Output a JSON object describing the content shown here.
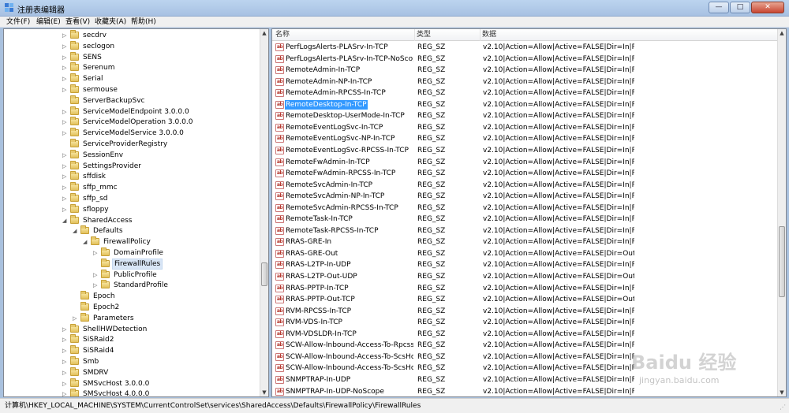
{
  "window": {
    "title": "注册表编辑器",
    "min_symbol": "—",
    "max_symbol": "□",
    "close_symbol": "✕"
  },
  "menu": [
    "文件(F)",
    "编辑(E)",
    "查看(V)",
    "收藏夹(A)",
    "帮助(H)"
  ],
  "tree": [
    {
      "label": "secdrv",
      "level": 0,
      "expander": "▷"
    },
    {
      "label": "seclogon",
      "level": 0,
      "expander": "▷"
    },
    {
      "label": "SENS",
      "level": 0,
      "expander": "▷"
    },
    {
      "label": "Serenum",
      "level": 0,
      "expander": "▷"
    },
    {
      "label": "Serial",
      "level": 0,
      "expander": "▷"
    },
    {
      "label": "sermouse",
      "level": 0,
      "expander": "▷"
    },
    {
      "label": "ServerBackupSvc",
      "level": 0,
      "expander": ""
    },
    {
      "label": "ServiceModelEndpoint 3.0.0.0",
      "level": 0,
      "expander": "▷"
    },
    {
      "label": "ServiceModelOperation 3.0.0.0",
      "level": 0,
      "expander": "▷"
    },
    {
      "label": "ServiceModelService 3.0.0.0",
      "level": 0,
      "expander": "▷"
    },
    {
      "label": "ServiceProviderRegistry",
      "level": 0,
      "expander": ""
    },
    {
      "label": "SessionEnv",
      "level": 0,
      "expander": "▷"
    },
    {
      "label": "SettingsProvider",
      "level": 0,
      "expander": "▷"
    },
    {
      "label": "sffdisk",
      "level": 0,
      "expander": "▷"
    },
    {
      "label": "sffp_mmc",
      "level": 0,
      "expander": "▷"
    },
    {
      "label": "sffp_sd",
      "level": 0,
      "expander": "▷"
    },
    {
      "label": "sfloppy",
      "level": 0,
      "expander": "▷"
    },
    {
      "label": "SharedAccess",
      "level": 0,
      "expander": "◢"
    },
    {
      "label": "Defaults",
      "level": 1,
      "expander": "◢"
    },
    {
      "label": "FirewallPolicy",
      "level": 2,
      "expander": "◢"
    },
    {
      "label": "DomainProfile",
      "level": 3,
      "expander": "▷"
    },
    {
      "label": "FirewallRules",
      "level": 3,
      "expander": "",
      "selected": true
    },
    {
      "label": "PublicProfile",
      "level": 3,
      "expander": "▷"
    },
    {
      "label": "StandardProfile",
      "level": 3,
      "expander": "▷"
    },
    {
      "label": "Epoch",
      "level": 1,
      "expander": ""
    },
    {
      "label": "Epoch2",
      "level": 1,
      "expander": ""
    },
    {
      "label": "Parameters",
      "level": 1,
      "expander": "▷"
    },
    {
      "label": "ShellHWDetection",
      "level": 0,
      "expander": "▷"
    },
    {
      "label": "SiSRaid2",
      "level": 0,
      "expander": "▷"
    },
    {
      "label": "SiSRaid4",
      "level": 0,
      "expander": "▷"
    },
    {
      "label": "Smb",
      "level": 0,
      "expander": "▷"
    },
    {
      "label": "SMDRV",
      "level": 0,
      "expander": "▷"
    },
    {
      "label": "SMSvcHost 3.0.0.0",
      "level": 0,
      "expander": "▷"
    },
    {
      "label": "SMSvcHost 4.0.0.0",
      "level": 0,
      "expander": "▷"
    }
  ],
  "list": {
    "headers": {
      "name": "名称",
      "type": "类型",
      "data": "数据"
    },
    "icon_text": "ab",
    "rows": [
      {
        "name": "PerfLogsAlerts-PLASrv-In-TCP",
        "type": "REG_SZ",
        "data": "v2.10|Action=Allow|Active=FALSE|Dir=In|Proto..."
      },
      {
        "name": "PerfLogsAlerts-PLASrv-In-TCP-NoScope",
        "type": "REG_SZ",
        "data": "v2.10|Action=Allow|Active=FALSE|Dir=In|Proto..."
      },
      {
        "name": "RemoteAdmin-In-TCP",
        "type": "REG_SZ",
        "data": "v2.10|Action=Allow|Active=FALSE|Dir=In|Proto..."
      },
      {
        "name": "RemoteAdmin-NP-In-TCP",
        "type": "REG_SZ",
        "data": "v2.10|Action=Allow|Active=FALSE|Dir=In|Proto..."
      },
      {
        "name": "RemoteAdmin-RPCSS-In-TCP",
        "type": "REG_SZ",
        "data": "v2.10|Action=Allow|Active=FALSE|Dir=In|Proto..."
      },
      {
        "name": "RemoteDesktop-In-TCP",
        "type": "REG_SZ",
        "data": "v2.10|Action=Allow|Active=FALSE|Dir=In|Proto...",
        "selected": true
      },
      {
        "name": "RemoteDesktop-UserMode-In-TCP",
        "type": "REG_SZ",
        "data": "v2.10|Action=Allow|Active=FALSE|Dir=In|Proto..."
      },
      {
        "name": "RemoteEventLogSvc-In-TCP",
        "type": "REG_SZ",
        "data": "v2.10|Action=Allow|Active=FALSE|Dir=In|Proto..."
      },
      {
        "name": "RemoteEventLogSvc-NP-In-TCP",
        "type": "REG_SZ",
        "data": "v2.10|Action=Allow|Active=FALSE|Dir=In|Proto..."
      },
      {
        "name": "RemoteEventLogSvc-RPCSS-In-TCP",
        "type": "REG_SZ",
        "data": "v2.10|Action=Allow|Active=FALSE|Dir=In|Proto..."
      },
      {
        "name": "RemoteFwAdmin-In-TCP",
        "type": "REG_SZ",
        "data": "v2.10|Action=Allow|Active=FALSE|Dir=In|Proto..."
      },
      {
        "name": "RemoteFwAdmin-RPCSS-In-TCP",
        "type": "REG_SZ",
        "data": "v2.10|Action=Allow|Active=FALSE|Dir=In|Proto..."
      },
      {
        "name": "RemoteSvcAdmin-In-TCP",
        "type": "REG_SZ",
        "data": "v2.10|Action=Allow|Active=FALSE|Dir=In|Proto..."
      },
      {
        "name": "RemoteSvcAdmin-NP-In-TCP",
        "type": "REG_SZ",
        "data": "v2.10|Action=Allow|Active=FALSE|Dir=In|Proto..."
      },
      {
        "name": "RemoteSvcAdmin-RPCSS-In-TCP",
        "type": "REG_SZ",
        "data": "v2.10|Action=Allow|Active=FALSE|Dir=In|Proto..."
      },
      {
        "name": "RemoteTask-In-TCP",
        "type": "REG_SZ",
        "data": "v2.10|Action=Allow|Active=FALSE|Dir=In|Proto..."
      },
      {
        "name": "RemoteTask-RPCSS-In-TCP",
        "type": "REG_SZ",
        "data": "v2.10|Action=Allow|Active=FALSE|Dir=In|Proto..."
      },
      {
        "name": "RRAS-GRE-In",
        "type": "REG_SZ",
        "data": "v2.10|Action=Allow|Active=FALSE|Dir=In|Proto..."
      },
      {
        "name": "RRAS-GRE-Out",
        "type": "REG_SZ",
        "data": "v2.10|Action=Allow|Active=FALSE|Dir=Out|Prot..."
      },
      {
        "name": "RRAS-L2TP-In-UDP",
        "type": "REG_SZ",
        "data": "v2.10|Action=Allow|Active=FALSE|Dir=In|Proto..."
      },
      {
        "name": "RRAS-L2TP-Out-UDP",
        "type": "REG_SZ",
        "data": "v2.10|Action=Allow|Active=FALSE|Dir=Out|Prot..."
      },
      {
        "name": "RRAS-PPTP-In-TCP",
        "type": "REG_SZ",
        "data": "v2.10|Action=Allow|Active=FALSE|Dir=In|Proto..."
      },
      {
        "name": "RRAS-PPTP-Out-TCP",
        "type": "REG_SZ",
        "data": "v2.10|Action=Allow|Active=FALSE|Dir=Out|Prot..."
      },
      {
        "name": "RVM-RPCSS-In-TCP",
        "type": "REG_SZ",
        "data": "v2.10|Action=Allow|Active=FALSE|Dir=In|Proto..."
      },
      {
        "name": "RVM-VDS-In-TCP",
        "type": "REG_SZ",
        "data": "v2.10|Action=Allow|Active=FALSE|Dir=In|Proto..."
      },
      {
        "name": "RVM-VDSLDR-In-TCP",
        "type": "REG_SZ",
        "data": "v2.10|Action=Allow|Active=FALSE|Dir=In|Proto..."
      },
      {
        "name": "SCW-Allow-Inbound-Access-To-Rpcss...",
        "type": "REG_SZ",
        "data": "v2.10|Action=Allow|Active=FALSE|Dir=In|Proto..."
      },
      {
        "name": "SCW-Allow-Inbound-Access-To-ScsHo...",
        "type": "REG_SZ",
        "data": "v2.10|Action=Allow|Active=FALSE|Dir=In|Proto..."
      },
      {
        "name": "SCW-Allow-Inbound-Access-To-ScsHo...",
        "type": "REG_SZ",
        "data": "v2.10|Action=Allow|Active=FALSE|Dir=In|Proto..."
      },
      {
        "name": "SNMPTRAP-In-UDP",
        "type": "REG_SZ",
        "data": "v2.10|Action=Allow|Active=FALSE|Dir=In|Proto..."
      },
      {
        "name": "SNMPTRAP-In-UDP-NoScope",
        "type": "REG_SZ",
        "data": "v2.10|Action=Allow|Active=FALSE|Dir=In|Proto..."
      }
    ]
  },
  "statusbar": {
    "path": "计算机\\HKEY_LOCAL_MACHINE\\SYSTEM\\CurrentControlSet\\services\\SharedAccess\\Defaults\\FirewallPolicy\\FirewallRules"
  },
  "watermark": {
    "main": "Baidu 经验",
    "url": "jingyan.baidu.com"
  },
  "colors": {
    "selection": "#3399ff",
    "tree_selection": "#d9e6f6",
    "titlebar": "#bcd4ef"
  }
}
